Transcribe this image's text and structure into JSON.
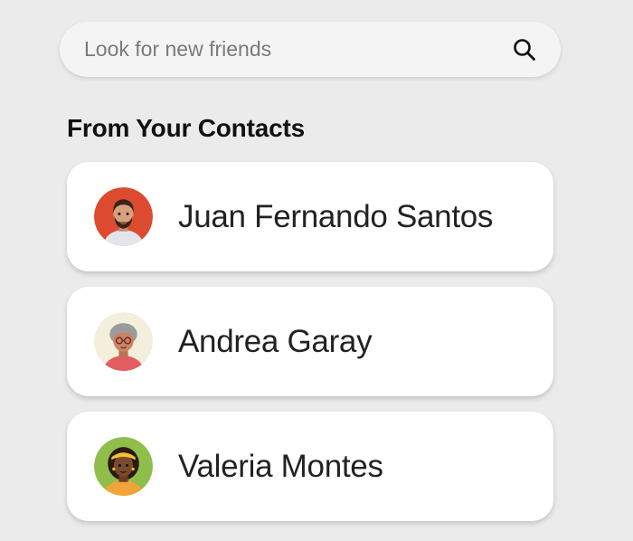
{
  "search": {
    "placeholder": "Look for new friends",
    "value": "",
    "icon": "search-icon"
  },
  "contacts_section": {
    "title": "From Your Contacts"
  },
  "contacts": [
    {
      "name": "Juan Fernando Santos",
      "avatar_bg": "#dc4a2f"
    },
    {
      "name": "Andrea Garay",
      "avatar_bg": "#f4eedd"
    },
    {
      "name": "Valeria Montes",
      "avatar_bg": "#8fbf4a"
    }
  ],
  "colors": {
    "page_background": "#ebebeb",
    "card_background": "#ffffff",
    "search_background": "#f4f4f4",
    "text_primary": "#222222"
  }
}
